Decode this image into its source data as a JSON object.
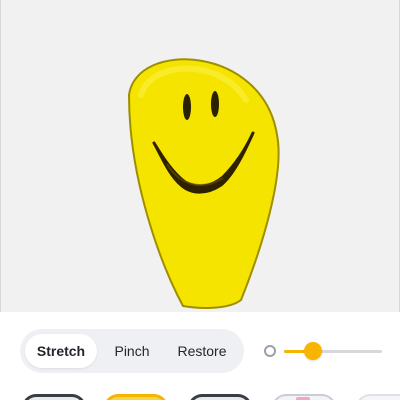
{
  "modes": {
    "stretch_label": "Stretch",
    "pinch_label": "Pinch",
    "restore_label": "Restore",
    "selected": "Stretch"
  },
  "slider": {
    "value": 0.3
  },
  "canvas": {
    "subject": "smiley-face",
    "face_color": "#f7e600",
    "background_color": "#f1f1f2"
  },
  "thumbnails": [
    {
      "icon": "preset-thumbnail",
      "selected": false
    },
    {
      "icon": "smiley-thumbnail",
      "selected": true
    },
    {
      "icon": "preset-thumbnail",
      "selected": false
    },
    {
      "icon": "preset-thumbnail",
      "selected": false
    },
    {
      "icon": "preset-thumbnail",
      "selected": false
    }
  ],
  "colors": {
    "accent": "#f7b500",
    "segment_bg": "#eef0f4",
    "text": "#23262e"
  }
}
